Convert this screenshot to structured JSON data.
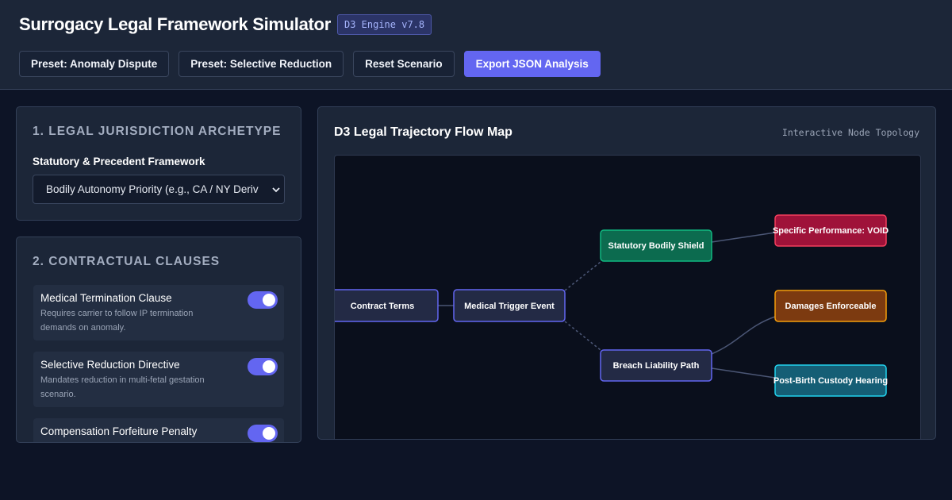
{
  "header": {
    "title": "Surrogacy Legal Framework Simulator",
    "engine_badge": "D3 Engine v7.8",
    "buttons": [
      "Preset: Anomaly Dispute",
      "Preset: Selective Reduction",
      "Reset Scenario",
      "Export JSON Analysis"
    ]
  },
  "jurisdiction": {
    "title": "1. LEGAL JURISDICTION ARCHETYPE",
    "field_label": "Statutory & Precedent Framework",
    "selected": "Bodily Autonomy Priority (e.g., CA / NY Deriv"
  },
  "clauses": {
    "title": "2. CONTRACTUAL CLAUSES",
    "items": [
      {
        "name": "Medical Termination Clause",
        "description": "Requires carrier to follow IP termination demands on anomaly.",
        "enabled": true
      },
      {
        "name": "Selective Reduction Directive",
        "description": "Mandates reduction in multi-fetal gestation scenario.",
        "enabled": true
      },
      {
        "name": "Compensation Forfeiture Penalty",
        "description": "",
        "enabled": true
      }
    ]
  },
  "flow_map": {
    "title": "D3 Legal Trajectory Flow Map",
    "subtitle": "Interactive Node Topology",
    "nodes": {
      "contract": "Contract Terms",
      "trigger": "Medical Trigger Event",
      "shield": "Statutory Bodily Shield",
      "breach": "Breach Liability Path",
      "void": "Specific Performance: VOID",
      "damages": "Damages Enforceable",
      "custody": "Post-Birth Custody Hearing"
    }
  },
  "colors": {
    "accent": "#6366f1",
    "shield": "#0c6b4f",
    "void": "#9f1239",
    "damages": "#7c3a10",
    "custody": "#155e75"
  }
}
